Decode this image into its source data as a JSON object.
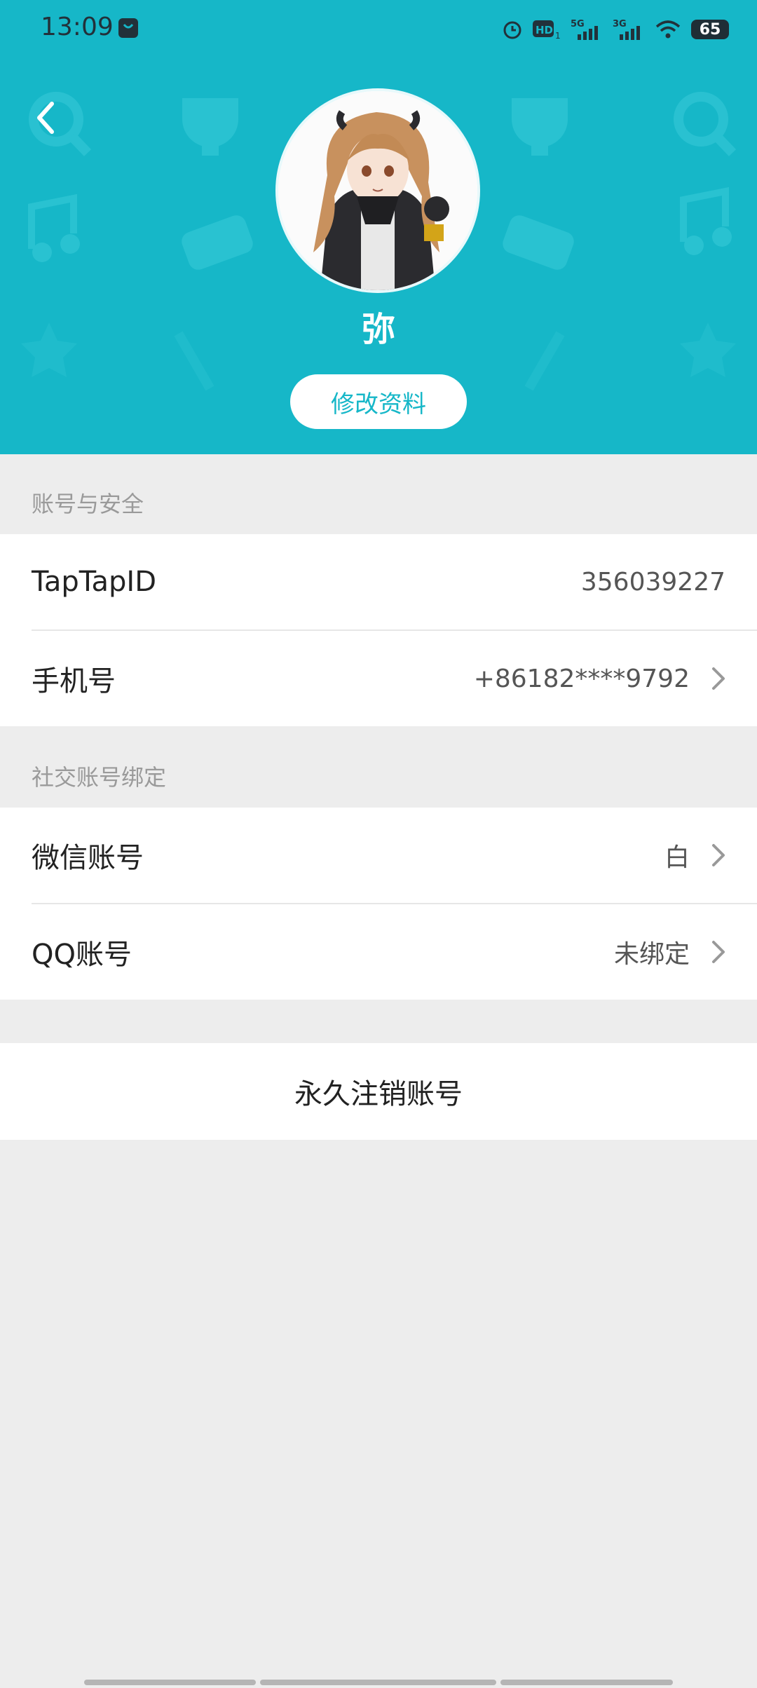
{
  "status_bar": {
    "time": "13:09",
    "battery": "65",
    "icons": [
      "bag-icon",
      "alarm-icon",
      "hd-icon",
      "signal-5g-icon",
      "signal-3g-icon",
      "wifi-icon",
      "battery-icon"
    ]
  },
  "profile": {
    "username": "弥",
    "edit_label": "修改资料"
  },
  "section_account": {
    "label": "账号与安全",
    "rows": [
      {
        "title": "TapTapID",
        "value": "356039227"
      },
      {
        "title": "手机号",
        "value": "+86182****9792"
      }
    ]
  },
  "section_social": {
    "label": "社交账号绑定",
    "rows": [
      {
        "title": "微信账号",
        "value": "白"
      },
      {
        "title": "QQ账号",
        "value": "未绑定"
      }
    ]
  },
  "delete_account_label": "永久注销账号",
  "colors": {
    "header_bg": "#16b7c8",
    "page_bg": "#ededed",
    "accent": "#16b7c8"
  }
}
